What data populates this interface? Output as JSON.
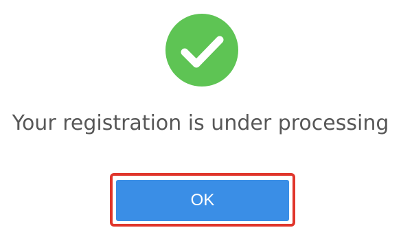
{
  "dialog": {
    "icon": "check-circle-icon",
    "message": "Your registration is under processing",
    "ok_label": "OK"
  },
  "colors": {
    "success_green": "#5ec454",
    "button_blue": "#3a8ee6",
    "highlight_red": "#e0352b",
    "message_text": "#575757"
  }
}
